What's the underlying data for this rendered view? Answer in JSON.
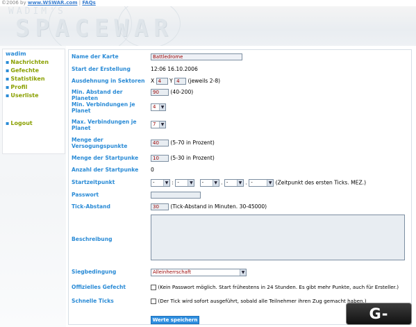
{
  "topbar": {
    "copyright": "©2006 by ",
    "site_link": "www.WSWAR.com",
    "separator": " | ",
    "faq_link": "FAQs"
  },
  "header": {
    "logo_small": "WADIM'S",
    "logo_big": "SPACEWAR"
  },
  "sidebar": {
    "user": "wadim",
    "items": [
      {
        "label": "Nachrichten"
      },
      {
        "label": "Gefechte"
      },
      {
        "label": "Statistiken"
      },
      {
        "label": "Profil"
      },
      {
        "label": "Userliste"
      }
    ],
    "logout": "Logout"
  },
  "form": {
    "map_name": {
      "label": "Name der Karte",
      "value": "Battledrome"
    },
    "start": {
      "label": "Start der Erstellung",
      "value": "12:06 16.10.2006"
    },
    "extent": {
      "label": "Ausdehnung in Sektoren",
      "x_label": "X",
      "x_value": "4",
      "y_label": "Y",
      "y_value": "4",
      "hint": "(jeweils 2-8)"
    },
    "min_distance": {
      "label": "Min. Abstand der Planeten",
      "value": "90",
      "hint": "(40-200)"
    },
    "min_connections": {
      "label": "Min. Verbindungen je Planet",
      "value": "4"
    },
    "max_connections": {
      "label": "Max. Verbindungen je Planet",
      "value": "7"
    },
    "supply": {
      "label": "Menge der Versogungspunkte",
      "value": "40",
      "hint": "(5-70 in Prozent)"
    },
    "start_points": {
      "label": "Menge der Startpunke",
      "value": "10",
      "hint": "(5-30 in Prozent)"
    },
    "start_count": {
      "label": "Anzahl der Startpunke",
      "value": "0"
    },
    "start_time": {
      "label": "Startzeitpunkt",
      "dash": "-",
      "colon": ":",
      "dot": ".",
      "hint": "(Zeitpunkt des ersten Ticks. MEZ.)"
    },
    "password": {
      "label": "Passwort",
      "value": ""
    },
    "tick": {
      "label": "Tick-Abstand",
      "value": "30",
      "hint": "(Tick-Abstand in Minuten. 30-45000)"
    },
    "description": {
      "label": "Beschreibung",
      "value": ""
    },
    "victory": {
      "label": "Siegbedingung",
      "value": "Alleinherrschaft"
    },
    "official": {
      "label": "Offizielles Gefecht",
      "hint": "(Kein Passwort möglich. Start frühestens in 24 Stunden. Es gibt mehr Punkte, auch für Ersteller.)"
    },
    "fast": {
      "label": "Schnelle Ticks",
      "hint": "(Der Tick wird sofort ausgeführt, sobald alle Teilnehmer ihren Zug gemacht haben.)"
    },
    "submit": "Werte speichern"
  },
  "watermark": "G-NEWS",
  "colors": {
    "label_blue": "#2a8bd6",
    "nav_green": "#8aa000",
    "button_blue": "#2f8fe0"
  }
}
